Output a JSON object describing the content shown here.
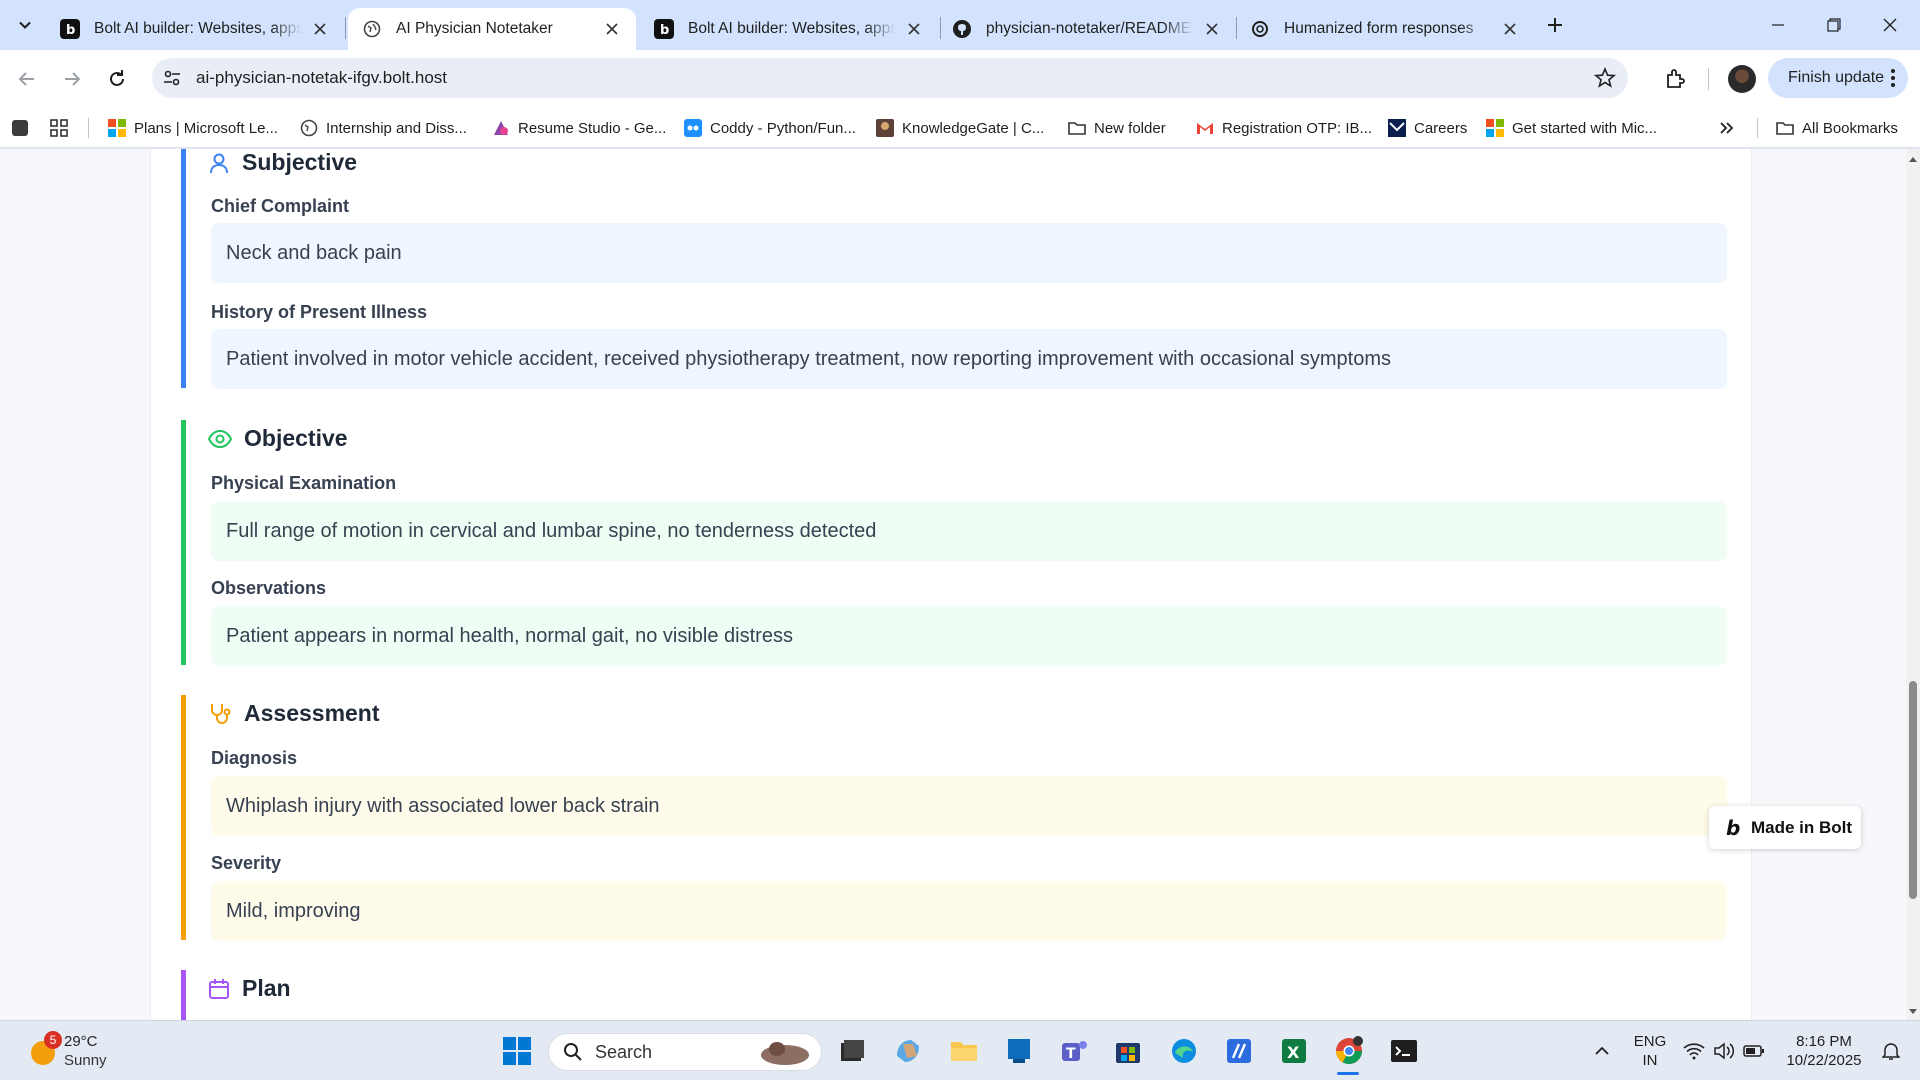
{
  "browser": {
    "tabs": [
      {
        "title": "Bolt AI builder: Websites, apps & prototypes",
        "favicon": "bolt-icon",
        "active": false
      },
      {
        "title": "AI Physician Notetaker",
        "favicon": "globe-icon",
        "active": true
      },
      {
        "title": "Bolt AI builder: Websites, apps & prototypes",
        "favicon": "bolt-icon",
        "active": false
      },
      {
        "title": "physician-notetaker/README.md",
        "favicon": "github-icon",
        "active": false
      },
      {
        "title": "Humanized form responses",
        "favicon": "openai-icon",
        "active": false
      }
    ],
    "url": "ai-physician-notetak-ifgv.bolt.host",
    "finish_update_label": "Finish update",
    "bookmarks": [
      "Plans | Microsoft Le...",
      "Internship and Diss...",
      "Resume Studio - Ge...",
      "Coddy - Python/Fun...",
      "KnowledgeGate | C...",
      "New folder",
      "Registration OTP: IB...",
      "Careers",
      "Get started with Mic..."
    ],
    "all_bookmarks_label": "All Bookmarks"
  },
  "soap": {
    "subjective": {
      "title": "Subjective",
      "color": "#3b82f6",
      "fields": [
        {
          "label": "Chief Complaint",
          "value": "Neck and back pain"
        },
        {
          "label": "History of Present Illness",
          "value": "Patient involved in motor vehicle accident, received physiotherapy treatment, now reporting improvement with occasional symptoms"
        }
      ]
    },
    "objective": {
      "title": "Objective",
      "color": "#22c55e",
      "fields": [
        {
          "label": "Physical Examination",
          "value": "Full range of motion in cervical and lumbar spine, no tenderness detected"
        },
        {
          "label": "Observations",
          "value": "Patient appears in normal health, normal gait, no visible distress"
        }
      ]
    },
    "assessment": {
      "title": "Assessment",
      "color": "#f59e0b",
      "fields": [
        {
          "label": "Diagnosis",
          "value": "Whiplash injury with associated lower back strain"
        },
        {
          "label": "Severity",
          "value": "Mild, improving"
        }
      ]
    },
    "plan": {
      "title": "Plan",
      "color": "#a855f7"
    }
  },
  "made_in_bolt_label": "Made in Bolt",
  "taskbar": {
    "weather_temp": "29°C",
    "weather_desc": "Sunny",
    "weather_badge": "5",
    "search_label": "Search",
    "lang_top": "ENG",
    "lang_bottom": "IN",
    "time": "8:16 PM",
    "date": "10/22/2025"
  }
}
